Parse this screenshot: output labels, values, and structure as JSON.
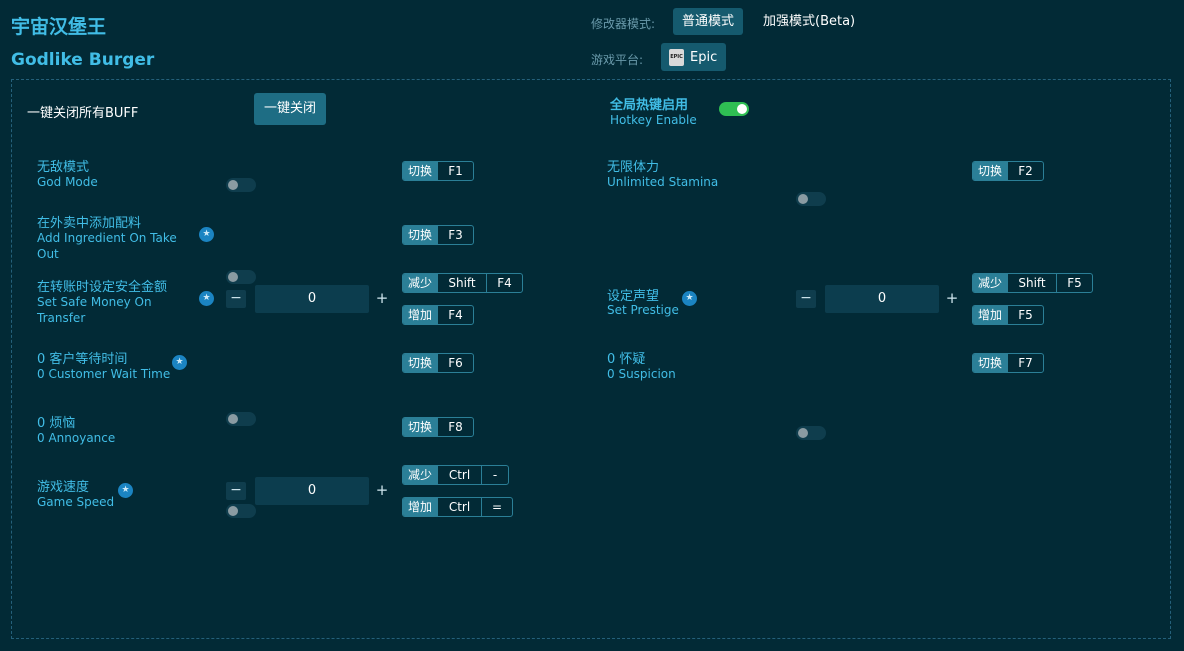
{
  "header": {
    "title_cn": "宇宙汉堡王",
    "title_en": "Godlike Burger",
    "mode_label": "修改器模式:",
    "mode_normal": "普通模式",
    "mode_enhanced": "加强模式(Beta)",
    "platform_label": "游戏平台:",
    "platform_name": "Epic",
    "platform_logo_text": "EPIC"
  },
  "top_controls": {
    "close_all_label": "一键关闭所有BUFF",
    "close_all_button": "一键关闭",
    "hotkey_cn": "全局热键启用",
    "hotkey_en": "Hotkey Enable",
    "hotkey_enabled": true
  },
  "keys": {
    "toggle": "切换",
    "decrease": "减少",
    "increase": "增加"
  },
  "cheats": {
    "god_mode": {
      "cn": "无敌模式",
      "en": "God Mode",
      "key": "F1"
    },
    "stamina": {
      "cn": "无限体力",
      "en": "Unlimited Stamina",
      "key": "F2"
    },
    "ingredient": {
      "cn": "在外卖中添加配料",
      "en": "Add Ingredient On Take Out",
      "key": "F3"
    },
    "safe_money": {
      "cn": "在转账时设定安全金额",
      "en": "Set Safe Money On Transfer",
      "value": "0",
      "dec_mod": "Shift",
      "dec_key": "F4",
      "inc_key": "F4"
    },
    "prestige": {
      "cn": "设定声望",
      "en": "Set Prestige",
      "value": "0",
      "dec_mod": "Shift",
      "dec_key": "F5",
      "inc_key": "F5"
    },
    "wait_time": {
      "cn": "0 客户等待时间",
      "en": "0 Customer Wait Time",
      "key": "F6"
    },
    "suspicion": {
      "cn": "0 怀疑",
      "en": "0 Suspicion",
      "key": "F7"
    },
    "annoyance": {
      "cn": "0 烦恼",
      "en": "0 Annoyance",
      "key": "F8"
    },
    "game_speed": {
      "cn": "游戏速度",
      "en": "Game Speed",
      "value": "0",
      "dec_mod": "Ctrl",
      "dec_key": "-",
      "inc_mod": "Ctrl",
      "inc_key": "="
    }
  },
  "icons": {
    "star": "★",
    "minus": "−",
    "plus": "+"
  },
  "colors": {
    "background": "#022a36",
    "accent": "#41bde6",
    "toggle_on": "#2fbe53",
    "key_badge": "#2b7f97"
  }
}
